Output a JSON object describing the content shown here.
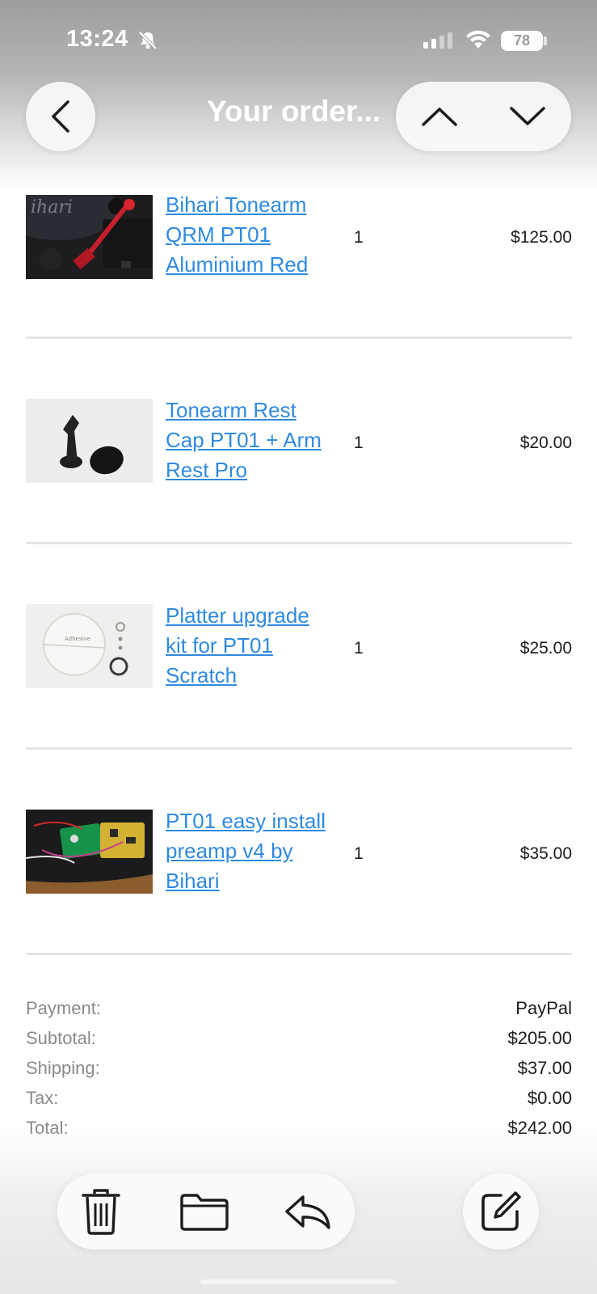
{
  "status_bar": {
    "time": "13:24",
    "battery": "78",
    "battery_level": 0.78
  },
  "header": {
    "title": "Your order..."
  },
  "items": [
    {
      "title_lines": [
        "Bihari Tonearm",
        "QRM PT01",
        "Aluminium Red"
      ],
      "qty": "1",
      "price": "$125.00"
    },
    {
      "title_lines": [
        "Tonearm Rest",
        "Cap PT01 + Arm",
        "Rest Pro"
      ],
      "qty": "1",
      "price": "$20.00"
    },
    {
      "title_lines": [
        "Platter upgrade",
        "kit for PT01",
        "Scratch"
      ],
      "qty": "1",
      "price": "$25.00",
      "thumb_text": "Adhesive"
    },
    {
      "title_lines": [
        "PT01 easy install",
        "preamp v4 by",
        "Bihari"
      ],
      "qty": "1",
      "price": "$35.00"
    }
  ],
  "summary": [
    {
      "label": "Payment:",
      "value": "PayPal"
    },
    {
      "label": "Subtotal:",
      "value": "$205.00"
    },
    {
      "label": "Shipping:",
      "value": "$37.00"
    },
    {
      "label": "Tax:",
      "value": "$0.00"
    },
    {
      "label": "Total:",
      "value": "$242.00"
    }
  ],
  "icons": {
    "back": "chevron-left-icon",
    "prev": "chevron-up-icon",
    "next": "chevron-down-icon",
    "delete": "trash-icon",
    "move": "folder-icon",
    "reply": "reply-icon",
    "compose": "compose-icon"
  },
  "colors": {
    "link": "#2f8ae0",
    "divider": "#e4e4e4",
    "label": "#8a8a8e"
  }
}
